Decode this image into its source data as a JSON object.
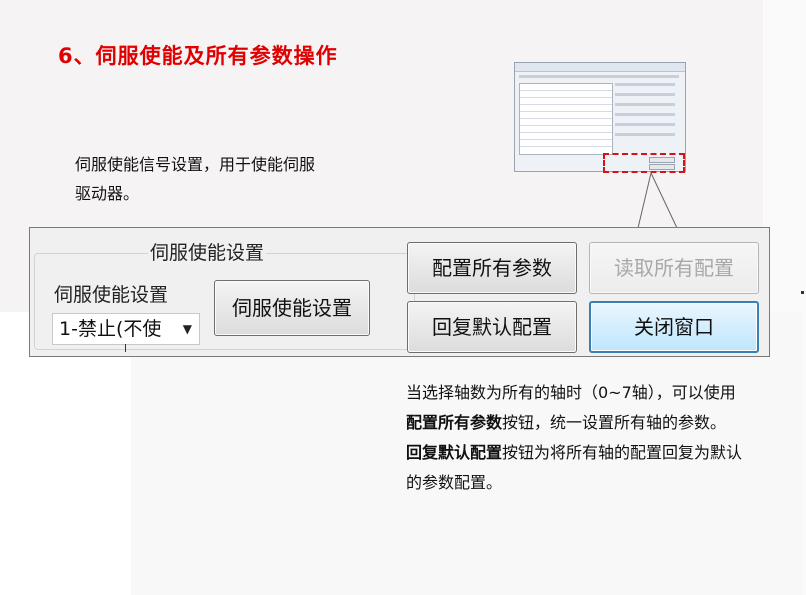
{
  "slide": {
    "title": "6、伺服使能及所有参数操作",
    "desc_servo_line1": "伺服使能信号设置，用于使能伺服",
    "desc_servo_line2": "驱动器。"
  },
  "panel": {
    "group_title": "伺服使能设置",
    "field_label": "伺服使能设置",
    "select_value": "1-禁止(不使",
    "servo_button": "伺服使能设置",
    "config_all_button": "配置所有参数",
    "read_all_button": "读取所有配置",
    "restore_button": "回复默认配置",
    "close_button": "关闭窗口"
  },
  "explanation": {
    "p1_a": "当选择轴数为所有的轴时（0~7轴），可以使用",
    "p1_bold": "配置所有参数",
    "p1_b": "按钮，统一设置所有轴的参数。",
    "p2_bold": "回复默认配置",
    "p2_b": "按钮为将所有轴的配置回复为默认的参数配置。"
  },
  "colors": {
    "title": "#e00000",
    "highlight_box": "#d41414",
    "close_button_border": "#3c7fb1"
  },
  "icons": {
    "dropdown": "chevron-down-icon"
  }
}
